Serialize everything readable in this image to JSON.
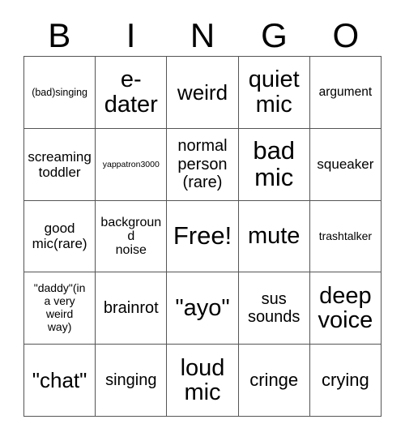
{
  "card": {
    "header_letters": [
      "B",
      "I",
      "N",
      "G",
      "O"
    ],
    "rows": [
      [
        {
          "text": "(bad)singing",
          "size": "fs-12"
        },
        {
          "text": "e-\ndater",
          "size": "fs-29"
        },
        {
          "text": "weird",
          "size": "fs-26"
        },
        {
          "text": "quiet\nmic",
          "size": "fs-29"
        },
        {
          "text": "argument",
          "size": "fs-15"
        }
      ],
      [
        {
          "text": "screaming\ntoddler",
          "size": "fs-17"
        },
        {
          "text": "yappatron3000",
          "size": "fs-10"
        },
        {
          "text": "normal\nperson\n(rare)",
          "size": "fs-20"
        },
        {
          "text": "bad\nmic",
          "size": "fs-31"
        },
        {
          "text": "squeaker",
          "size": "fs-17"
        }
      ],
      [
        {
          "text": "good\nmic(rare)",
          "size": "fs-17"
        },
        {
          "text": "background\nnoise",
          "size": "fs-13"
        },
        {
          "text": "Free!",
          "size": "fs-31"
        },
        {
          "text": "mute",
          "size": "fs-29"
        },
        {
          "text": "trashtalker",
          "size": "fs-14"
        }
      ],
      [
        {
          "text": "\"daddy\"(in\na very\nweird\nway)",
          "size": "fs-14"
        },
        {
          "text": "brainrot",
          "size": "fs-20"
        },
        {
          "text": "\"ayo\"",
          "size": "fs-29"
        },
        {
          "text": "sus\nsounds",
          "size": "fs-20"
        },
        {
          "text": "deep\nvoice",
          "size": "fs-29"
        }
      ],
      [
        {
          "text": "\"chat\"",
          "size": "fs-26"
        },
        {
          "text": "singing",
          "size": "fs-20"
        },
        {
          "text": "loud\nmic",
          "size": "fs-29"
        },
        {
          "text": "cringe",
          "size": "fs-22"
        },
        {
          "text": "crying",
          "size": "fs-22"
        }
      ]
    ],
    "free_space": {
      "row": 2,
      "col": 2,
      "label": "Free!"
    },
    "colors": {
      "background": "#ffffff",
      "text": "#000000",
      "grid_border": "#555555"
    }
  }
}
